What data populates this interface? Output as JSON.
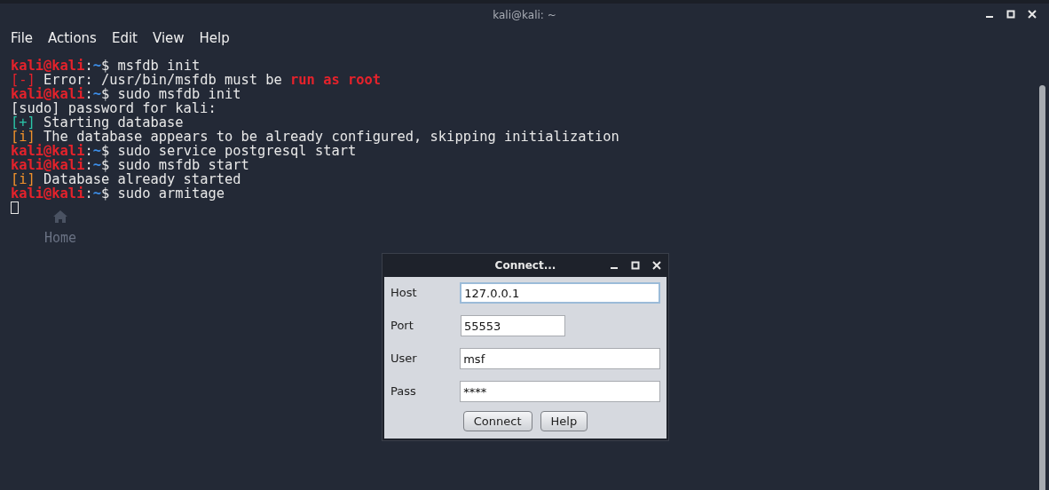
{
  "window": {
    "title": "kali@kali: ~"
  },
  "menu": [
    "File",
    "Actions",
    "Edit",
    "View",
    "Help"
  ],
  "desktop_icon": {
    "label": "Home"
  },
  "terminal": {
    "lines": [
      [
        {
          "kind": "prompt",
          "text": "kali@kali"
        },
        {
          "kind": "plain",
          "text": ":"
        },
        {
          "kind": "path",
          "text": "~"
        },
        {
          "kind": "plain",
          "text": "$ msfdb init"
        }
      ],
      [
        {
          "kind": "error_tag",
          "text": "[-]"
        },
        {
          "kind": "plain",
          "text": " Error: /usr/bin/msfdb must be "
        },
        {
          "kind": "error_em",
          "text": "run as root"
        }
      ],
      [
        {
          "kind": "prompt",
          "text": "kali@kali"
        },
        {
          "kind": "plain",
          "text": ":"
        },
        {
          "kind": "path",
          "text": "~"
        },
        {
          "kind": "plain",
          "text": "$ sudo msfdb init"
        }
      ],
      [
        {
          "kind": "plain",
          "text": "[sudo] password for kali:"
        }
      ],
      [
        {
          "kind": "ok_tag",
          "text": "[+]"
        },
        {
          "kind": "plain",
          "text": " Starting database"
        }
      ],
      [
        {
          "kind": "info_tag",
          "text": "[i]"
        },
        {
          "kind": "plain",
          "text": " The database appears to be already configured, skipping initialization"
        }
      ],
      [
        {
          "kind": "prompt",
          "text": "kali@kali"
        },
        {
          "kind": "plain",
          "text": ":"
        },
        {
          "kind": "path",
          "text": "~"
        },
        {
          "kind": "plain",
          "text": "$ sudo service postgresql start"
        }
      ],
      [
        {
          "kind": "prompt",
          "text": "kali@kali"
        },
        {
          "kind": "plain",
          "text": ":"
        },
        {
          "kind": "path",
          "text": "~"
        },
        {
          "kind": "plain",
          "text": "$ sudo msfdb start"
        }
      ],
      [
        {
          "kind": "info_tag",
          "text": "[i]"
        },
        {
          "kind": "plain",
          "text": " Database already started"
        }
      ],
      [
        {
          "kind": "prompt",
          "text": "kali@kali"
        },
        {
          "kind": "plain",
          "text": ":"
        },
        {
          "kind": "path",
          "text": "~"
        },
        {
          "kind": "plain",
          "text": "$ sudo armitage"
        }
      ]
    ]
  },
  "dialog": {
    "title": "Connect...",
    "fields": [
      {
        "label": "Host",
        "value": "127.0.0.1",
        "focused": true,
        "kind": "wide"
      },
      {
        "label": "Port",
        "value": "55553",
        "focused": false,
        "kind": "short"
      },
      {
        "label": "User",
        "value": "msf",
        "focused": false,
        "kind": "wide"
      },
      {
        "label": "Pass",
        "value": "****",
        "focused": false,
        "kind": "wide"
      }
    ],
    "buttons": [
      "Connect",
      "Help"
    ]
  }
}
